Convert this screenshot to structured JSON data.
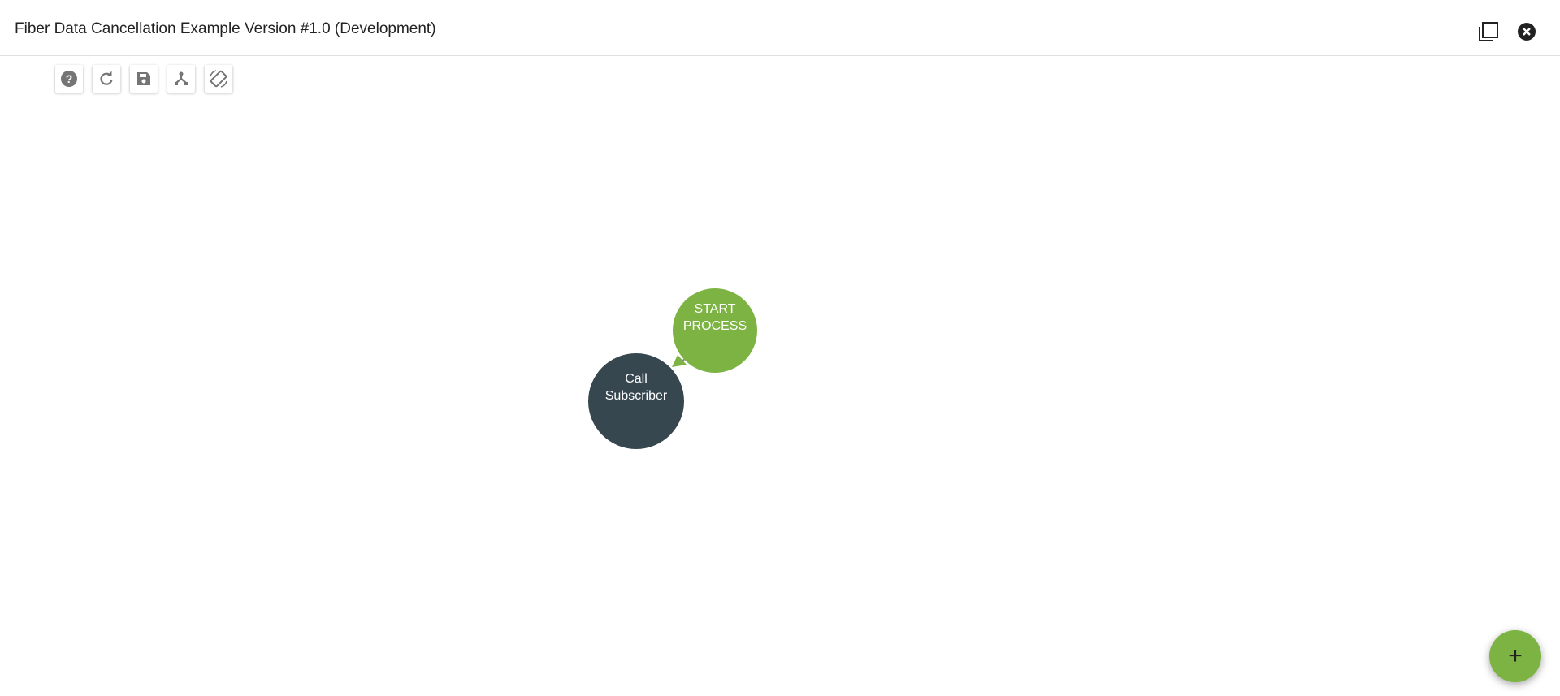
{
  "header": {
    "title": "Fiber Data Cancellation Example Version #1.0 (Development)"
  },
  "toolbar": {
    "buttons": [
      {
        "name": "help-button",
        "icon": "help-icon"
      },
      {
        "name": "refresh-button",
        "icon": "refresh-icon"
      },
      {
        "name": "save-button",
        "icon": "save-icon"
      },
      {
        "name": "layout-button",
        "icon": "hierarchy-icon"
      },
      {
        "name": "rotate-button",
        "icon": "rotate-icon"
      }
    ]
  },
  "diagram": {
    "nodes": [
      {
        "label_line1": "START",
        "label_line2": "PROCESS",
        "color": "#7cb342"
      },
      {
        "label_line1": "Call",
        "label_line2": "Subscriber",
        "color": "#37474f"
      }
    ],
    "edge_color": "#7cb342"
  },
  "fab": {
    "label": "+",
    "color": "#7cb342"
  }
}
